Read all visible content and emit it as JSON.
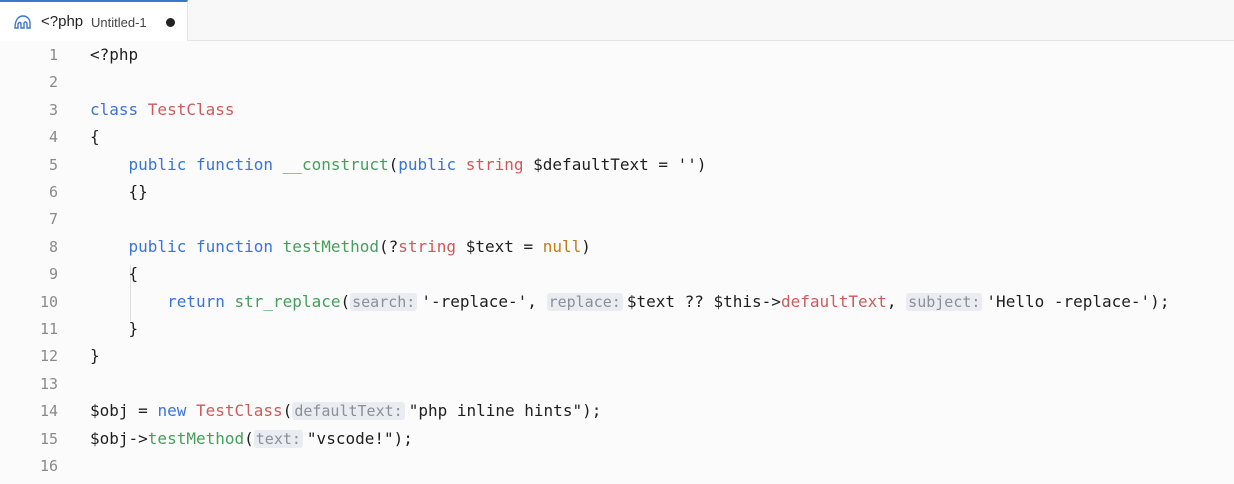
{
  "tab": {
    "language": "<?php",
    "filename": "Untitled-1",
    "icon": "php-elephant-icon"
  },
  "colors": {
    "keyword": "#3b73d9",
    "class": "#cd5a5a",
    "function": "#44a05a",
    "hint_bg": "#e9ecf1"
  },
  "lines": [
    {
      "n": "1",
      "segs": [
        {
          "t": "<?php",
          "c": ""
        }
      ]
    },
    {
      "n": "2",
      "segs": []
    },
    {
      "n": "3",
      "segs": [
        {
          "t": "class ",
          "c": "kw"
        },
        {
          "t": "TestClass",
          "c": "cls"
        }
      ]
    },
    {
      "n": "4",
      "segs": [
        {
          "t": "{",
          "c": ""
        }
      ]
    },
    {
      "n": "5",
      "segs": [
        {
          "t": "    ",
          "c": ""
        },
        {
          "t": "public ",
          "c": "kw"
        },
        {
          "t": "function ",
          "c": "kw"
        },
        {
          "t": "__construct",
          "c": "fn"
        },
        {
          "t": "(",
          "c": ""
        },
        {
          "t": "public ",
          "c": "kw"
        },
        {
          "t": "string ",
          "c": "cls"
        },
        {
          "t": "$defaultText = ''",
          "c": ""
        },
        {
          "t": ")",
          "c": ""
        }
      ]
    },
    {
      "n": "6",
      "segs": [
        {
          "t": "    {}",
          "c": ""
        }
      ]
    },
    {
      "n": "7",
      "segs": []
    },
    {
      "n": "8",
      "segs": [
        {
          "t": "    ",
          "c": ""
        },
        {
          "t": "public ",
          "c": "kw"
        },
        {
          "t": "function ",
          "c": "kw"
        },
        {
          "t": "testMethod",
          "c": "fn"
        },
        {
          "t": "(?",
          "c": ""
        },
        {
          "t": "string ",
          "c": "cls"
        },
        {
          "t": "$text = ",
          "c": ""
        },
        {
          "t": "null",
          "c": "num"
        },
        {
          "t": ")",
          "c": ""
        }
      ]
    },
    {
      "n": "9",
      "segs": [
        {
          "t": "    {",
          "c": ""
        }
      ]
    },
    {
      "n": "10",
      "segs": [
        {
          "t": "        ",
          "c": ""
        },
        {
          "t": "return ",
          "c": "kw"
        },
        {
          "t": "str_replace",
          "c": "fn"
        },
        {
          "t": "(",
          "c": ""
        },
        {
          "t": "search:",
          "c": "hint"
        },
        {
          "t": "'-replace-', ",
          "c": ""
        },
        {
          "t": "replace:",
          "c": "hint"
        },
        {
          "t": "$text ?? $this->",
          "c": ""
        },
        {
          "t": "defaultText",
          "c": "prop"
        },
        {
          "t": ", ",
          "c": ""
        },
        {
          "t": "subject:",
          "c": "hint"
        },
        {
          "t": "'Hello -replace-');",
          "c": ""
        }
      ]
    },
    {
      "n": "11",
      "segs": [
        {
          "t": "    }",
          "c": ""
        }
      ]
    },
    {
      "n": "12",
      "segs": [
        {
          "t": "}",
          "c": ""
        }
      ]
    },
    {
      "n": "13",
      "segs": []
    },
    {
      "n": "14",
      "segs": [
        {
          "t": "$obj = ",
          "c": ""
        },
        {
          "t": "new ",
          "c": "kw"
        },
        {
          "t": "TestClass",
          "c": "cls"
        },
        {
          "t": "(",
          "c": ""
        },
        {
          "t": "defaultText:",
          "c": "hint"
        },
        {
          "t": "\"php inline hints\");",
          "c": ""
        }
      ]
    },
    {
      "n": "15",
      "segs": [
        {
          "t": "$obj->",
          "c": ""
        },
        {
          "t": "testMethod",
          "c": "fn"
        },
        {
          "t": "(",
          "c": ""
        },
        {
          "t": "text:",
          "c": "hint"
        },
        {
          "t": "\"vscode!\");",
          "c": ""
        }
      ]
    },
    {
      "n": "16",
      "segs": []
    }
  ]
}
